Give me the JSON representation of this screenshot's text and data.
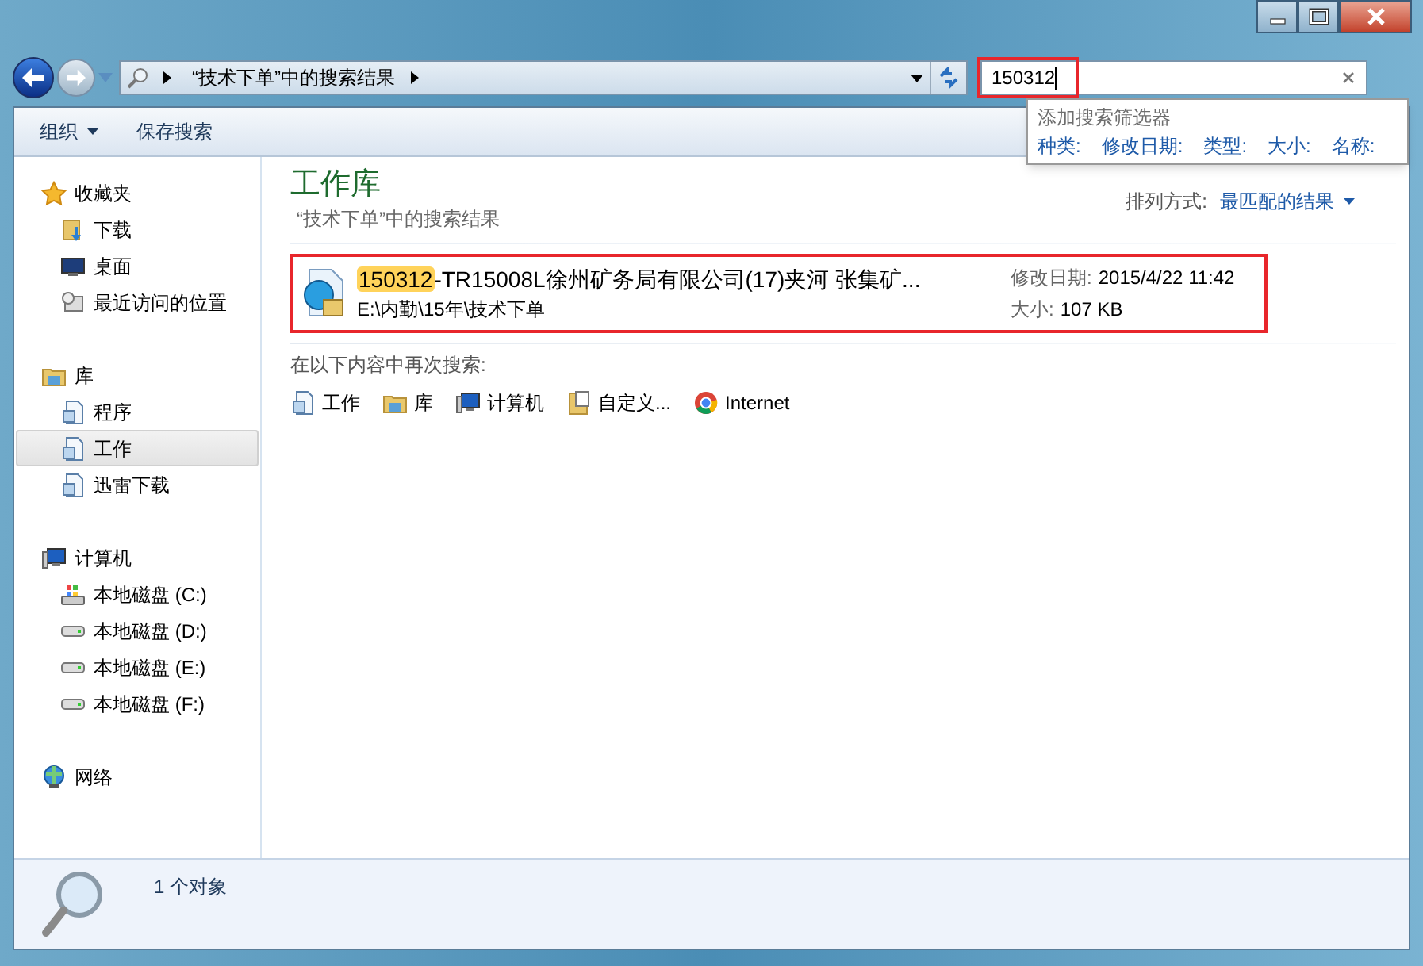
{
  "address_bar": {
    "path": "“技术下单”中的搜索结果"
  },
  "search": {
    "value": "150312",
    "highlighted": true,
    "suggestions_title": "添加搜索筛选器",
    "filters": [
      "种类:",
      "修改日期:",
      "类型:",
      "大小:",
      "名称:"
    ]
  },
  "toolbar": {
    "buttons": [
      {
        "label": "组织"
      },
      {
        "label": "保存搜索"
      }
    ]
  },
  "sidebar": {
    "groups": [
      {
        "label": "收藏夹",
        "items": [
          {
            "label": "下载",
            "selected": false
          },
          {
            "label": "桌面",
            "selected": false
          },
          {
            "label": "最近访问的位置",
            "selected": false
          }
        ]
      },
      {
        "label": "库",
        "items": [
          {
            "label": "程序",
            "selected": false
          },
          {
            "label": "工作",
            "selected": true
          },
          {
            "label": "迅雷下载",
            "selected": false
          }
        ]
      },
      {
        "label": "计算机",
        "items": [
          {
            "label": "本地磁盘 (C:)",
            "selected": false
          },
          {
            "label": "本地磁盘 (D:)",
            "selected": false
          },
          {
            "label": "本地磁盘 (E:)",
            "selected": false
          },
          {
            "label": "本地磁盘 (F:)",
            "selected": false
          }
        ]
      },
      {
        "label": "网络"
      }
    ]
  },
  "content": {
    "title": "工作库",
    "subtitle": "“技术下单”中的搜索结果",
    "sort_label": "排列方式:",
    "sort_value": "最匹配的结果",
    "results": [
      {
        "name_match": "150312",
        "name_rest": "-TR15008L徐州矿务局有限公司(17)夹河 张集矿...",
        "path": "E:\\内勤\\15年\\技术下单",
        "date_label": "修改日期:",
        "date": "2015/4/22 11:42",
        "size_label": "大小:",
        "size": "107 KB",
        "highlighted": true
      }
    ],
    "search_again_label": "在以下内容中再次搜索:",
    "search_again": [
      {
        "label": "工作"
      },
      {
        "label": "库"
      },
      {
        "label": "计算机"
      },
      {
        "label": "自定义..."
      },
      {
        "label": "Internet"
      }
    ]
  },
  "status_bar": {
    "text": "1 个对象"
  }
}
